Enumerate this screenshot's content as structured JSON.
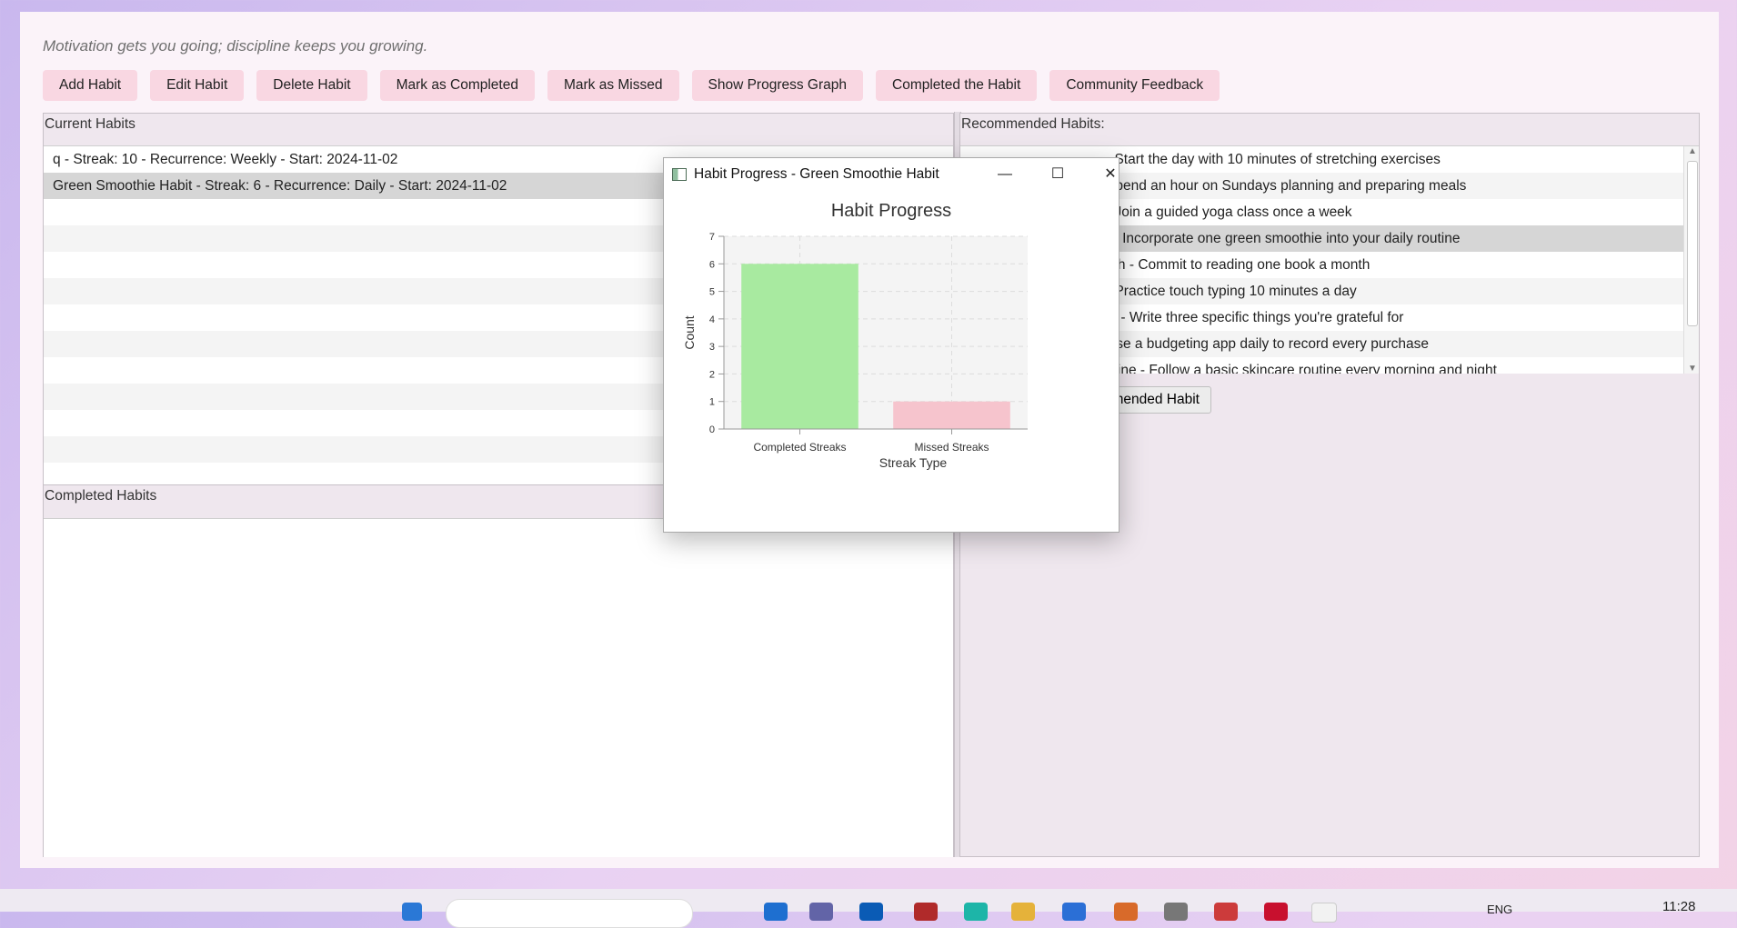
{
  "motto": "Motivation gets you going; discipline keeps you growing.",
  "toolbar": {
    "add": "Add Habit",
    "edit": "Edit Habit",
    "delete": "Delete Habit",
    "complete": "Mark as Completed",
    "missed": "Mark as Missed",
    "graph": "Show Progress Graph",
    "completed": "Completed the Habit",
    "community": "Community Feedback"
  },
  "current_habits": {
    "title": "Current Habits",
    "items": [
      "q - Streak: 10 - Recurrence: Weekly - Start: 2024-11-02",
      "Green Smoothie Habit - Streak: 6 - Recurrence: Daily - Start: 2024-11-02"
    ],
    "selected_index": 1
  },
  "completed_habits": {
    "title": "Completed Habits"
  },
  "recommended": {
    "title": "Recommended Habits:",
    "items": [
      "- Start the day with 10 minutes of stretching exercises",
      "Spend an hour on Sundays planning and preparing meals",
      "- Join a guided yoga class once a week",
      "t - Incorporate one green smoothie into your daily routine",
      "nth - Commit to reading one book a month",
      "- Practice touch typing 10 minutes a day",
      "al - Write three specific things you're grateful for",
      "Use a budgeting app daily to record every purchase",
      "utine - Follow a basic skincare routine every morning and night"
    ],
    "selected_index": 3,
    "add_button": "mended Habit"
  },
  "dialog": {
    "title": "Habit Progress - Green Smoothie Habit"
  },
  "chart_data": {
    "type": "bar",
    "title": "Habit Progress",
    "xlabel": "Streak Type",
    "ylabel": "Count",
    "categories": [
      "Completed Streaks",
      "Missed Streaks"
    ],
    "values": [
      6,
      1
    ],
    "colors": [
      "#a8eaa0",
      "#f6c4cd"
    ],
    "ylim": [
      0,
      7
    ],
    "yticks": [
      0,
      1,
      2,
      3,
      4,
      5,
      6,
      7
    ],
    "grid": true
  },
  "taskbar": {
    "lang": "ENG",
    "time": "11:28"
  }
}
